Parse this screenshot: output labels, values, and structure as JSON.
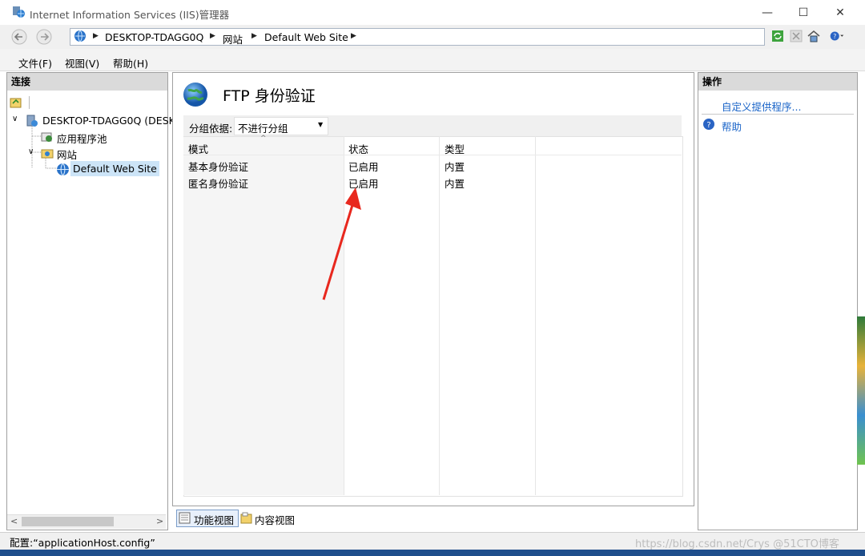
{
  "window": {
    "title": "Internet Information Services (IIS)管理器",
    "minimize": "—",
    "maximize": "☐",
    "close": "✕"
  },
  "address": {
    "crumbs": [
      "DESKTOP-TDAGG0Q",
      "网站",
      "Default Web Site"
    ]
  },
  "menu": [
    "文件(F)",
    "视图(V)",
    "帮助(H)"
  ],
  "connections": {
    "header": "连接",
    "tree": [
      {
        "label": "DESKTOP-TDAGG0Q (DESK",
        "icon": "server-icon"
      },
      {
        "label": "应用程序池",
        "icon": "app-pool-icon"
      },
      {
        "label": "网站",
        "icon": "sites-folder-icon"
      },
      {
        "label": "Default Web Site",
        "icon": "website-globe-icon",
        "selected": true
      }
    ]
  },
  "feature": {
    "title": "FTP 身份验证",
    "group_by_label": "分组依据:",
    "group_by_value": "不进行分组",
    "columns": [
      "模式",
      "状态",
      "类型"
    ],
    "rows": [
      {
        "mode": "基本身份验证",
        "status": "已启用",
        "type": "内置"
      },
      {
        "mode": "匿名身份验证",
        "status": "已启用",
        "type": "内置"
      }
    ],
    "tabs": [
      "功能视图",
      "内容视图"
    ]
  },
  "actions": {
    "header": "操作",
    "items": [
      {
        "label": "自定义提供程序...",
        "icon": ""
      },
      {
        "label": "帮助",
        "icon": "help-icon"
      }
    ]
  },
  "status": {
    "text": "配置:“applicationHost.config”",
    "watermark": "https://blog.csdn.net/Crys @51CTO博客"
  },
  "colors": {
    "accent_blue": "#1a5fb4",
    "link_blue": "#1a64c8",
    "arrow_red": "#e8281e",
    "selection": "#cce4f7"
  }
}
